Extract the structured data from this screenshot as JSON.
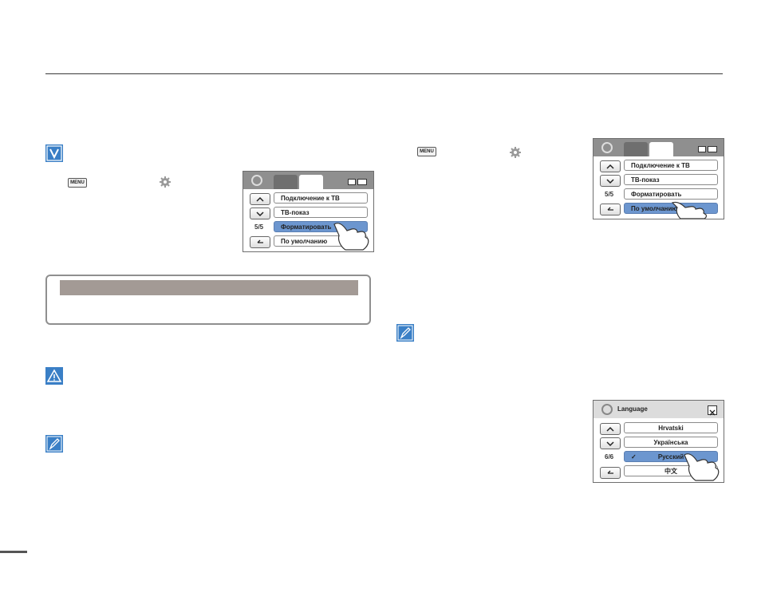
{
  "icons": {
    "check": "check-icon",
    "warning": "warning-icon",
    "note": "note-pencil-icon",
    "gear": "gear-icon",
    "menu": "menu-key-icon"
  },
  "menu_key_label": "MENU",
  "panel_tv": {
    "items": [
      "Подключение к ТВ",
      "ТВ-показ",
      "Форматировать",
      "По умолчанию"
    ],
    "selected_index": 2,
    "page": "5/5"
  },
  "panel_tv_right": {
    "items": [
      "Подключение к ТВ",
      "ТВ-показ",
      "Форматировать",
      "По умолчанию"
    ],
    "selected_index": 3,
    "page": "5/5"
  },
  "panel_language": {
    "title": "Language",
    "items": [
      "Hrvatski",
      "Українська",
      "Русский",
      "中文"
    ],
    "selected_index": 2,
    "page": "6/6"
  },
  "colors": {
    "accent_blue": "#3a7fc6",
    "selection_blue": "#6c96cf",
    "bar_gray": "#a39a95"
  }
}
